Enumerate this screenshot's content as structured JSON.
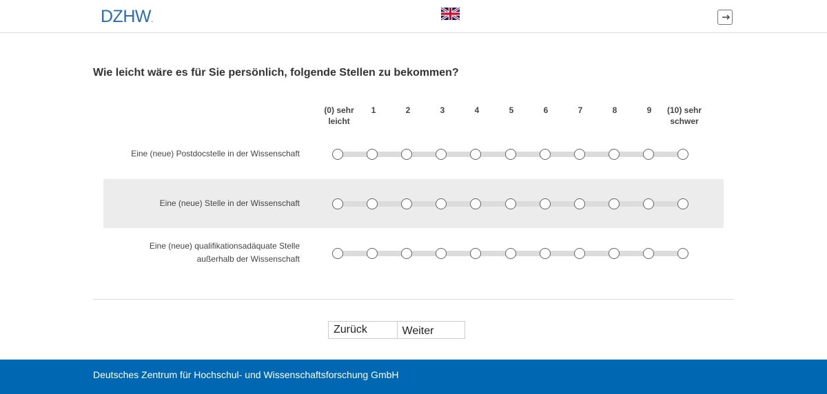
{
  "header": {
    "logo_text": "DZHW",
    "logo_dot": ".",
    "language_flag": "uk-flag-icon",
    "logout_icon": "logout-icon"
  },
  "question": {
    "text": "Wie leicht wäre es für Sie persönlich, folgende Stellen zu bekommen?"
  },
  "scale": {
    "labels": [
      "(0) sehr leicht",
      "1",
      "2",
      "3",
      "4",
      "5",
      "6",
      "7",
      "8",
      "9",
      "(10) sehr schwer"
    ],
    "label_0_line1": "(0) sehr",
    "label_0_line2": "leicht",
    "label_10_line1": "(10) sehr",
    "label_10_line2": "schwer"
  },
  "items": [
    {
      "label": "Eine (neue) Postdocstelle in der Wissenschaft",
      "selected": null
    },
    {
      "label": "Eine (neue) Stelle in der Wissenschaft",
      "selected": null
    },
    {
      "label_line1": "Eine (neue) qualifikationsadäquate Stelle",
      "label_line2": "außerhalb der Wissenschaft",
      "selected": null
    }
  ],
  "buttons": {
    "back_label": "Zurück",
    "next_label": "Weiter"
  },
  "footer": {
    "text": "Deutsches Zentrum für Hochschul- und Wissenschaftsforschung GmbH"
  },
  "colors": {
    "brand_blue": "#0068b3",
    "logo_blue": "#2a6db5",
    "row_shade": "#ececec"
  }
}
